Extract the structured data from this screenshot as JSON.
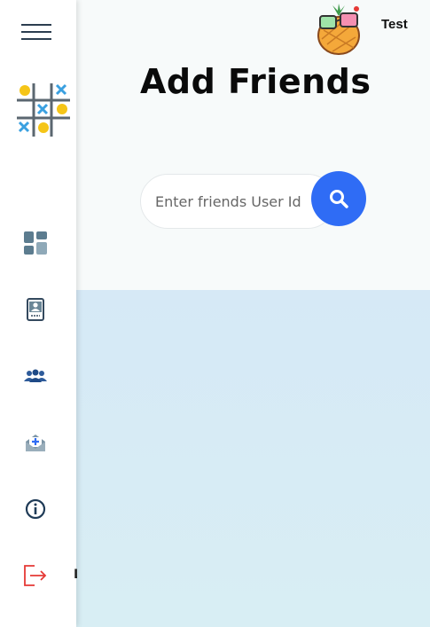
{
  "header": {
    "username": "Test",
    "avatar_icon": "pineapple-sunglasses-avatar-icon"
  },
  "main": {
    "title": "Add Friends",
    "search": {
      "placeholder": "Enter friends User Id",
      "value": "",
      "button_icon": "search-icon"
    }
  },
  "sidebar": {
    "menu_icon": "hamburger-menu-icon",
    "logo": "tic-tac-toe-logo-icon",
    "items": [
      {
        "icon": "dashboard-icon"
      },
      {
        "icon": "profile-card-icon"
      },
      {
        "icon": "friends-group-icon"
      },
      {
        "icon": "mail-plus-icon"
      },
      {
        "icon": "info-icon"
      },
      {
        "icon": "logout-icon",
        "label": "L"
      }
    ]
  },
  "colors": {
    "accent": "#2f6cf5",
    "sidebar_bg": "#ffffff",
    "main_bg_top": "#f7fafa",
    "main_bg_bottom": "#d8ecf5",
    "logout_red": "#e53935",
    "logo_yellow": "#f5c518",
    "logo_blue": "#3aa0e0"
  }
}
